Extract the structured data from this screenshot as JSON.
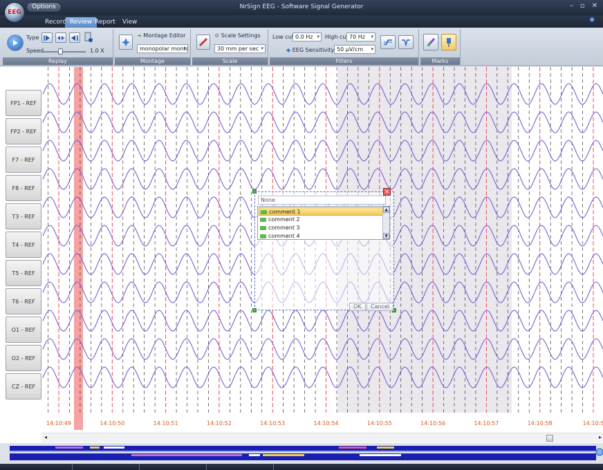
{
  "app": {
    "orb_label": "EEG",
    "options_label": "Options",
    "window_title": "NrSign EEG  -  Software Signal Generator",
    "window_controls": [
      "–",
      "▫",
      "✕"
    ]
  },
  "tabs": [
    {
      "label": "Record",
      "active": false
    },
    {
      "label": "Review",
      "active": true
    },
    {
      "label": "Report",
      "active": false
    },
    {
      "label": "View",
      "active": false
    }
  ],
  "ribbon": {
    "replay": {
      "group_label": "Replay",
      "type_label": "Type",
      "speed_label": "Speed",
      "speed_value": "1.0 X",
      "speed_level": 0.4
    },
    "montage": {
      "group_label": "Montage",
      "editor_label": "Montage Editor",
      "montage_value": "monopolar monta"
    },
    "scale": {
      "group_label": "Scale",
      "settings_label": "Scale Settings",
      "scale_value": "30 mm per sec"
    },
    "filters": {
      "group_label": "Filters",
      "low_cut_label": "Low cut",
      "low_cut_value": "0.0 Hz",
      "high_cut_label": "High cut",
      "high_cut_value": "70 Hz",
      "sensitivity_label": "EEG Sensitivity",
      "sensitivity_value": "50 µV/cm"
    },
    "marks": {
      "group_label": "Marks"
    }
  },
  "channels": [
    "FP1 - REF",
    "FP2 - REF",
    "F7 - REF",
    "F8 - REF",
    "T3 - REF",
    "T4 - REF",
    "T5 - REF",
    "T6 - REF",
    "O1 - REF",
    "O2 - REF",
    "CZ - REF"
  ],
  "time_labels": [
    "14:10:49",
    "14:10:50",
    "14:10:51",
    "14:10:52",
    "14:10:53",
    "14:10:54",
    "14:10:55",
    "14:10:56",
    "14:10:57",
    "14:10:58",
    "14:10:5"
  ],
  "comment_popup": {
    "combo_value": "None",
    "items": [
      "comment 1",
      "comment 2",
      "comment 3",
      "comment 4"
    ],
    "selected_index": 0,
    "ok_label": "OK",
    "cancel_label": "Cancel"
  },
  "colors": {
    "signal": "#7b5fd0",
    "second_marker": "#e8485a",
    "sub_marker": "#3a3a3a",
    "event_marker": "#f07a7a",
    "selection_shade": "#d9d6de",
    "time_label": "#d35a1c"
  }
}
